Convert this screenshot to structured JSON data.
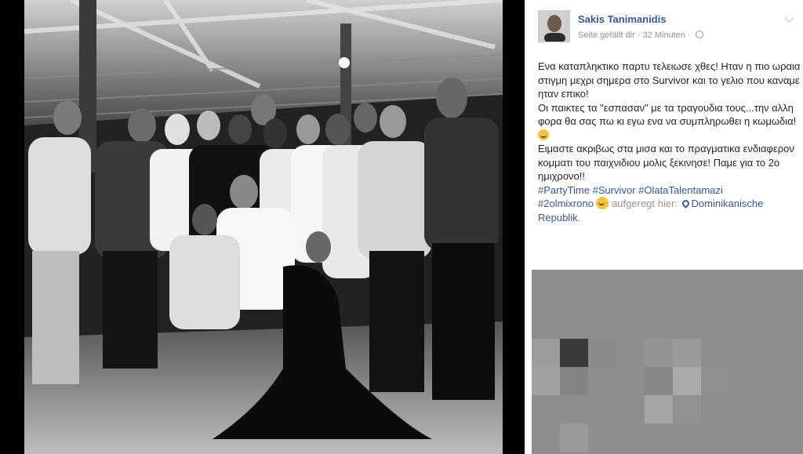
{
  "post": {
    "author": "Sakis Tanimanidis",
    "meta_liked": "Seite gefällt dir",
    "meta_sep": " · ",
    "meta_time": "32 Minuten",
    "meta_sep2": " · ",
    "para1": "Ενα καταπληκτικο παρτυ τελειωσε χθες! Ηταν η πιο ωραια στιγμη μεχρι σημερα στο Survivor και το γελιο που καναμε ηταν επικο!",
    "para2": "Οι παικτες τα \"εσπασαν\" με τα τραγουδια τους...την αλλη φορα θα σας πω κι εγω ενα να συμπληρωθει η κωμωδια!",
    "para3": "Ειμαστε ακριβως στα μισα και το πραγματικα ενδιαφερον κομματι του παιχνιδιου μολις ξεκινησε! Παμε για το 2ο ημιχρονο!!",
    "hashtags": "#PartyTime #Survivor #OlataTalentamazi",
    "hashtag_last": "#2olmixrono",
    "feeling": "aufgeregt hier:",
    "location": "Dominikanische Republik",
    "location_end": "."
  },
  "icons": {
    "avatar": "avatar-photo",
    "globe": "globe-icon",
    "chevron": "chevron-down-icon",
    "emoji": "laughing-emoji-icon",
    "location": "location-pin-icon"
  },
  "colors": {
    "link": "#365899",
    "text": "#1d2129",
    "muted": "#90949c"
  }
}
